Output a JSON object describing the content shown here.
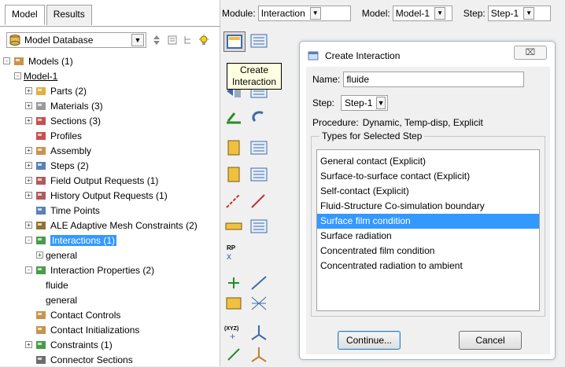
{
  "left_tabs": [
    "Model",
    "Results"
  ],
  "model_database_label": "Model Database",
  "tree": [
    {
      "label": "Models (1)",
      "level": 0,
      "expander": "-",
      "icon": "models-icon"
    },
    {
      "label": "Model-1",
      "level": 1,
      "expander": "-",
      "icon": "",
      "underline": true
    },
    {
      "label": "Parts (2)",
      "level": 2,
      "expander": "+",
      "icon": "parts-icon"
    },
    {
      "label": "Materials (3)",
      "level": 2,
      "expander": "+",
      "icon": "materials-icon"
    },
    {
      "label": "Sections (3)",
      "level": 2,
      "expander": "+",
      "icon": "sections-icon"
    },
    {
      "label": "Profiles",
      "level": 2,
      "expander": "",
      "icon": "profiles-icon"
    },
    {
      "label": "Assembly",
      "level": 2,
      "expander": "+",
      "icon": "assembly-icon"
    },
    {
      "label": "Steps (2)",
      "level": 2,
      "expander": "+",
      "icon": "steps-icon"
    },
    {
      "label": "Field Output Requests (1)",
      "level": 2,
      "expander": "+",
      "icon": "field-output-icon"
    },
    {
      "label": "History Output Requests (1)",
      "level": 2,
      "expander": "+",
      "icon": "history-output-icon"
    },
    {
      "label": "Time Points",
      "level": 2,
      "expander": "",
      "icon": "time-points-icon"
    },
    {
      "label": "ALE Adaptive Mesh Constraints (2)",
      "level": 2,
      "expander": "+",
      "icon": "ale-icon"
    },
    {
      "label": "Interactions (1)",
      "level": 2,
      "expander": "-",
      "icon": "interactions-icon",
      "selected": true
    },
    {
      "label": "general",
      "level": 3,
      "expander": "+",
      "icon": ""
    },
    {
      "label": "Interaction Properties (2)",
      "level": 2,
      "expander": "-",
      "icon": "interaction-properties-icon"
    },
    {
      "label": "fluide",
      "level": 3,
      "expander": "",
      "icon": ""
    },
    {
      "label": "general",
      "level": 3,
      "expander": "",
      "icon": ""
    },
    {
      "label": "Contact Controls",
      "level": 2,
      "expander": "",
      "icon": "contact-controls-icon"
    },
    {
      "label": "Contact Initializations",
      "level": 2,
      "expander": "",
      "icon": "contact-init-icon"
    },
    {
      "label": "Constraints (1)",
      "level": 2,
      "expander": "+",
      "icon": "constraints-icon"
    },
    {
      "label": "Connector Sections",
      "level": 2,
      "expander": "",
      "icon": "connector-sections-icon"
    }
  ],
  "topbar": {
    "module_label": "Module:",
    "module_value": "Interaction",
    "model_label": "Model:",
    "model_value": "Model-1",
    "step_label": "Step:",
    "step_value": "Step-1"
  },
  "tooltip": {
    "line1": "Create",
    "line2": "Interaction"
  },
  "dialog": {
    "title": "Create Interaction",
    "close_symbol": "⌧",
    "name_label": "Name:",
    "name_value": "fluide",
    "step_label": "Step:",
    "step_value": "Step-1",
    "procedure_label": "Procedure:",
    "procedure_value": "Dynamic, Temp-disp, Explicit",
    "types_legend": "Types for Selected Step",
    "types": [
      "General contact (Explicit)",
      "Surface-to-surface contact (Explicit)",
      "Self-contact (Explicit)",
      "Fluid-Structure Co-simulation boundary",
      "Surface film condition",
      "Surface radiation",
      "Concentrated film condition",
      "Concentrated radiation to ambient"
    ],
    "selected_type": "Surface film condition",
    "continue_label": "Continue...",
    "cancel_label": "Cancel"
  },
  "colors": {
    "selection": "#3399ff",
    "tooltip_bg": "#ffffe1"
  }
}
